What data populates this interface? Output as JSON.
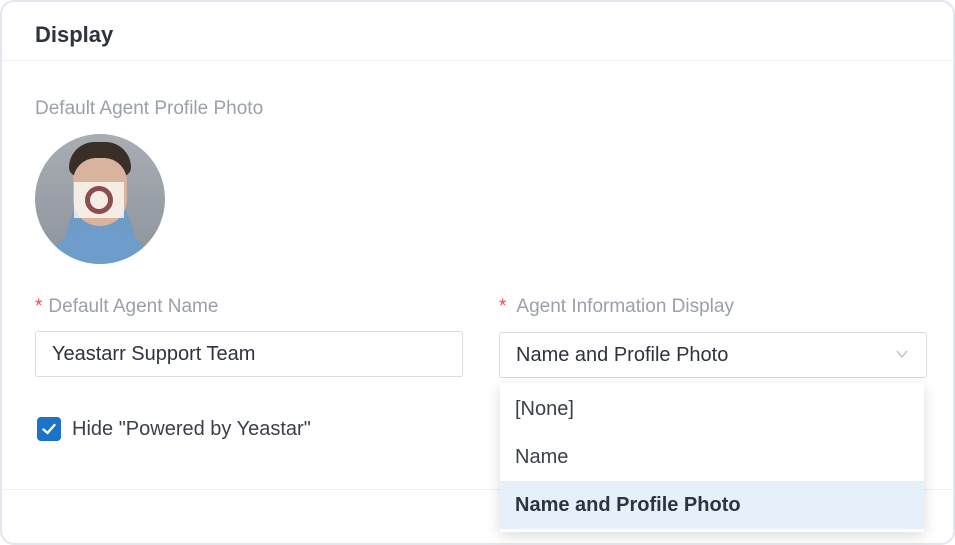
{
  "section": {
    "title": "Display"
  },
  "profile_photo": {
    "label": "Default Agent Profile Photo"
  },
  "agent_name": {
    "label": "Default Agent Name",
    "required_mark": "*",
    "value": "Yeastarr Support Team"
  },
  "agent_info_display": {
    "label": "Agent Information Display",
    "required_mark": "*",
    "selected": "Name and Profile Photo",
    "options": [
      "[None]",
      "Name",
      "Name and Profile Photo"
    ]
  },
  "hide_powered_by": {
    "label": "Hide \"Powered by Yeastar\"",
    "checked": true
  },
  "colors": {
    "accent": "#1a73c7",
    "required": "#ea4b4b",
    "selected_bg": "#e6f0fa"
  },
  "icons": {
    "checkbox": "check-icon",
    "dropdown": "chevron-down-icon",
    "photo": "camera-icon"
  }
}
